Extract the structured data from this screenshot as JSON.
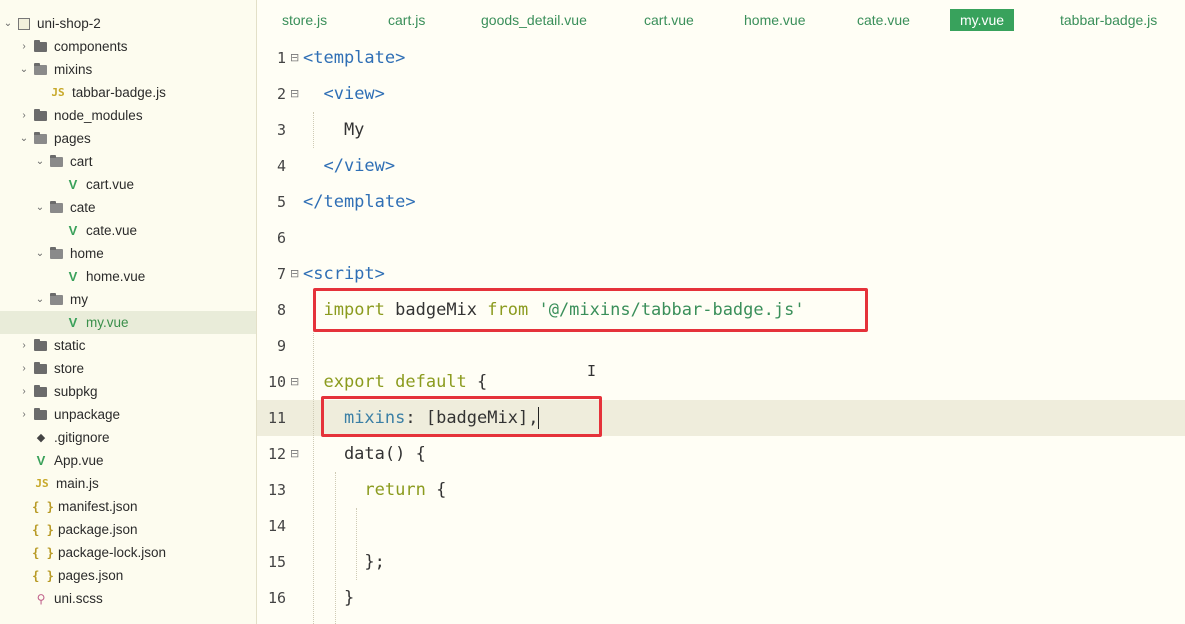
{
  "tree": [
    {
      "label": "uni-shop-2",
      "type": "project",
      "arrow": "open",
      "depth": 0
    },
    {
      "label": "components",
      "type": "folder",
      "arrow": "closed",
      "depth": 1
    },
    {
      "label": "mixins",
      "type": "folder-open",
      "arrow": "open",
      "depth": 1
    },
    {
      "label": "tabbar-badge.js",
      "type": "js",
      "arrow": "none",
      "depth": 2
    },
    {
      "label": "node_modules",
      "type": "folder",
      "arrow": "closed",
      "depth": 1
    },
    {
      "label": "pages",
      "type": "folder-open",
      "arrow": "open",
      "depth": 1
    },
    {
      "label": "cart",
      "type": "folder-open",
      "arrow": "open",
      "depth": 2
    },
    {
      "label": "cart.vue",
      "type": "vue",
      "arrow": "none",
      "depth": 3
    },
    {
      "label": "cate",
      "type": "folder-open",
      "arrow": "open",
      "depth": 2
    },
    {
      "label": "cate.vue",
      "type": "vue",
      "arrow": "none",
      "depth": 3
    },
    {
      "label": "home",
      "type": "folder-open",
      "arrow": "open",
      "depth": 2
    },
    {
      "label": "home.vue",
      "type": "vue",
      "arrow": "none",
      "depth": 3
    },
    {
      "label": "my",
      "type": "folder-open",
      "arrow": "open",
      "depth": 2
    },
    {
      "label": "my.vue",
      "type": "vue",
      "arrow": "none",
      "depth": 3,
      "selected": true
    },
    {
      "label": "static",
      "type": "folder",
      "arrow": "closed",
      "depth": 1
    },
    {
      "label": "store",
      "type": "folder",
      "arrow": "closed",
      "depth": 1
    },
    {
      "label": "subpkg",
      "type": "folder",
      "arrow": "closed",
      "depth": 1
    },
    {
      "label": "unpackage",
      "type": "folder",
      "arrow": "closed",
      "depth": 1
    },
    {
      "label": ".gitignore",
      "type": "git",
      "arrow": "none",
      "depth": 1
    },
    {
      "label": "App.vue",
      "type": "vue",
      "arrow": "none",
      "depth": 1
    },
    {
      "label": "main.js",
      "type": "js",
      "arrow": "none",
      "depth": 1
    },
    {
      "label": "manifest.json",
      "type": "json",
      "arrow": "none",
      "depth": 1
    },
    {
      "label": "package.json",
      "type": "json",
      "arrow": "none",
      "depth": 1
    },
    {
      "label": "package-lock.json",
      "type": "json",
      "arrow": "none",
      "depth": 1
    },
    {
      "label": "pages.json",
      "type": "json",
      "arrow": "none",
      "depth": 1
    },
    {
      "label": "uni.scss",
      "type": "scss",
      "arrow": "none",
      "depth": 1
    }
  ],
  "icons": {
    "js": "JS",
    "vue": "V",
    "json": "{ }",
    "git": "◆",
    "scss": "⚲"
  },
  "tabs": [
    {
      "label": "store.js"
    },
    {
      "label": "cart.js"
    },
    {
      "label": "goods_detail.vue"
    },
    {
      "label": "cart.vue"
    },
    {
      "label": "home.vue"
    },
    {
      "label": "cate.vue"
    },
    {
      "label": "my.vue",
      "active": true
    },
    {
      "label": "tabbar-badge.js"
    }
  ],
  "code_lines": [
    {
      "num": "1",
      "fold": true,
      "tokens": [
        [
          "tag",
          "<template>"
        ]
      ]
    },
    {
      "num": "2",
      "fold": true,
      "tokens": [
        [
          "plain",
          "  "
        ],
        [
          "tag",
          "<view>"
        ]
      ]
    },
    {
      "num": "3",
      "fold": false,
      "tokens": [
        [
          "plain",
          "    My"
        ]
      ]
    },
    {
      "num": "4",
      "fold": false,
      "tokens": [
        [
          "plain",
          "  "
        ],
        [
          "tag",
          "</view>"
        ]
      ]
    },
    {
      "num": "5",
      "fold": false,
      "tokens": [
        [
          "tag",
          "</template>"
        ]
      ]
    },
    {
      "num": "6",
      "fold": false,
      "tokens": []
    },
    {
      "num": "7",
      "fold": true,
      "tokens": [
        [
          "tag",
          "<script>"
        ]
      ]
    },
    {
      "num": "8",
      "fold": false,
      "tokens": [
        [
          "plain",
          "  "
        ],
        [
          "kw",
          "import"
        ],
        [
          "plain",
          " badgeMix "
        ],
        [
          "kw",
          "from"
        ],
        [
          "plain",
          " "
        ],
        [
          "str",
          "'@/mixins/tabbar-badge.js'"
        ]
      ]
    },
    {
      "num": "9",
      "fold": false,
      "tokens": []
    },
    {
      "num": "10",
      "fold": true,
      "tokens": [
        [
          "plain",
          "  "
        ],
        [
          "kw",
          "export default"
        ],
        [
          "plain",
          " {"
        ]
      ]
    },
    {
      "num": "11",
      "fold": false,
      "current": true,
      "tokens": [
        [
          "plain",
          "    "
        ],
        [
          "prop",
          "mixins"
        ],
        [
          "plain",
          ": [badgeMix],"
        ]
      ]
    },
    {
      "num": "12",
      "fold": true,
      "tokens": [
        [
          "plain",
          "    data() {"
        ]
      ]
    },
    {
      "num": "13",
      "fold": false,
      "tokens": [
        [
          "plain",
          "      "
        ],
        [
          "kw",
          "return"
        ],
        [
          "plain",
          " {"
        ]
      ]
    },
    {
      "num": "14",
      "fold": false,
      "tokens": []
    },
    {
      "num": "15",
      "fold": false,
      "tokens": [
        [
          "plain",
          "      };"
        ]
      ]
    },
    {
      "num": "16",
      "fold": false,
      "tokens": [
        [
          "plain",
          "    }"
        ]
      ]
    }
  ],
  "accent_colors": {
    "tab_active": "#38a25c",
    "highlight_box": "#e5323a",
    "keyword": "#8b9b1e",
    "tag": "#2f6fb5",
    "string": "#3a8f5a"
  }
}
